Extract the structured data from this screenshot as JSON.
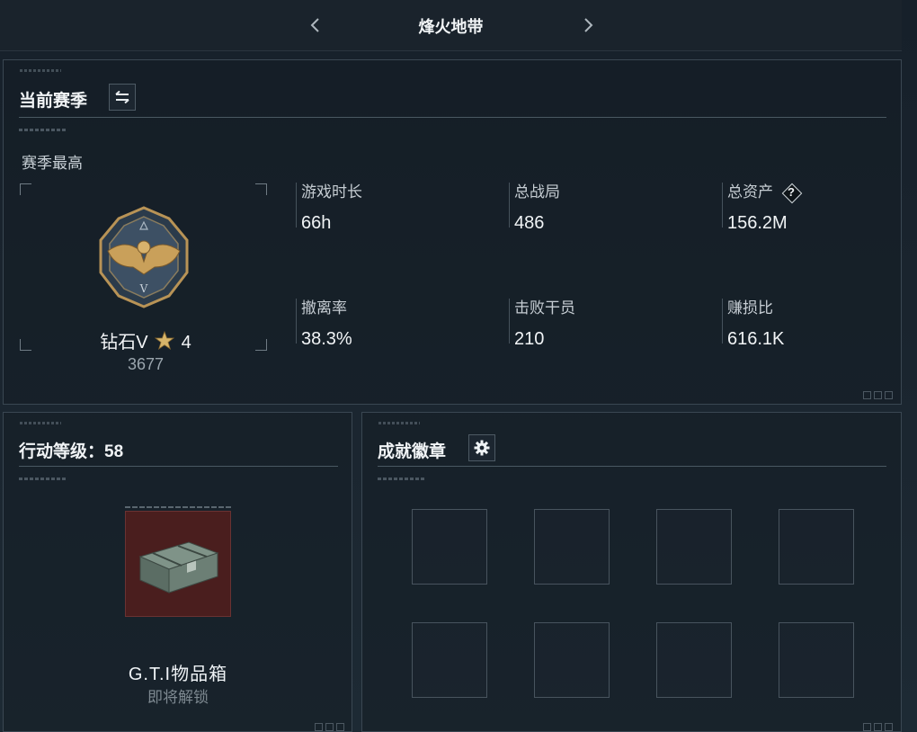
{
  "header": {
    "title": "烽火地带"
  },
  "season": {
    "title": "当前赛季",
    "best_label": "赛季最高",
    "rank": {
      "name": "钻石V",
      "stars": "4",
      "score": "3677"
    },
    "stats": [
      {
        "label": "游戏时长",
        "value": "66h"
      },
      {
        "label": "总战局",
        "value": "486"
      },
      {
        "label": "总资产",
        "value": "156.2M",
        "help": "?"
      },
      {
        "label": "撤离率",
        "value": "38.3%"
      },
      {
        "label": "击败干员",
        "value": "210"
      },
      {
        "label": "赚损比",
        "value": "616.1K"
      }
    ]
  },
  "level": {
    "title": "行动等级：58",
    "reward_name": "G.T.I物品箱",
    "reward_status": "即将解锁"
  },
  "achievements": {
    "title": "成就徽章"
  },
  "icons": {
    "prev": "chevron-left-icon",
    "next": "chevron-right-icon",
    "swap": "swap-arrows-icon",
    "gear": "gear-icon",
    "help": "question-diamond-icon",
    "medal": "eagle-medal-icon",
    "star": "gold-star-icon",
    "crate": "supply-crate-icon"
  },
  "colors": {
    "accent_gold": "#d6a85a",
    "crate_bg": "#4a1e1e",
    "panel_border": "#3a4752"
  }
}
